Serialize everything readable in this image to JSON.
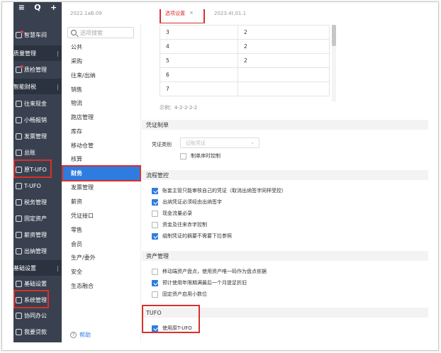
{
  "sidebar": {
    "topbar": [
      "≡",
      "Q",
      "+"
    ],
    "items": [
      {
        "label": "智慧车间",
        "type": "item",
        "dot": true
      },
      {
        "label": "质量管理",
        "type": "section"
      },
      {
        "label": "质检管理",
        "type": "item",
        "dot": true
      },
      {
        "label": "智能财税",
        "type": "section"
      },
      {
        "label": "往来现金",
        "type": "item"
      },
      {
        "label": "小畅报销",
        "type": "item"
      },
      {
        "label": "发票管理",
        "type": "item"
      },
      {
        "label": "总账",
        "type": "item"
      },
      {
        "label": "原T-UFO",
        "type": "item"
      },
      {
        "label": "T-UFO",
        "type": "item"
      },
      {
        "label": "税务管理",
        "type": "item"
      },
      {
        "label": "固定资产",
        "type": "item"
      },
      {
        "label": "薪资管理",
        "type": "item"
      },
      {
        "label": "出纳管理",
        "type": "item"
      },
      {
        "label": "基础设置",
        "type": "section"
      },
      {
        "label": "基础设置",
        "type": "item"
      },
      {
        "label": "系统管理",
        "type": "item"
      },
      {
        "label": "协同办公",
        "type": "item"
      },
      {
        "label": "我要贷款",
        "type": "item"
      }
    ]
  },
  "tabs": {
    "left": "2022.1aB.09",
    "active": "选项设置",
    "active_close": "×",
    "right": "2023.4t.01.1"
  },
  "menu": {
    "search_placeholder": "选项搜索",
    "items": [
      "公共",
      "采购",
      "往来/出纳",
      "销售",
      "物流",
      "跑店管理",
      "库存",
      "移动仓管",
      "核算",
      "财务",
      "发票管理",
      "薪资",
      "凭证接口",
      "零售",
      "会员",
      "生产/委外",
      "安全",
      "生态融合"
    ],
    "active": "财务",
    "help": "帮助",
    "help_icon": "?"
  },
  "content": {
    "table_rows": [
      [
        "3",
        "2"
      ],
      [
        "4",
        "2"
      ],
      [
        "5",
        "2"
      ],
      [
        "6",
        ""
      ],
      [
        "7",
        ""
      ]
    ],
    "example": "示例：4-2-2-2-2",
    "voucher_section": {
      "title": "凭证制单",
      "type_label": "凭证类别",
      "type_value": "记账凭证",
      "select_arrow": "⌄",
      "control": {
        "label": "制单序时控制",
        "checked": false
      }
    },
    "process_section": {
      "title": "流程管控",
      "options": [
        {
          "label": "账套主管只能审核自己的凭证（取消出纳签字同样受控）",
          "checked": true
        },
        {
          "label": "出纳凭证必须经由出纳签字",
          "checked": true
        },
        {
          "label": "现金流量必录",
          "checked": false
        },
        {
          "label": "资金及往来赤字控制",
          "checked": false
        },
        {
          "label": "组制凭证的摘要不需要下拉参照",
          "checked": true
        }
      ]
    },
    "asset_section": {
      "title": "资产管理",
      "options": [
        {
          "label": "移动端资产盘点，使用资产唯一码作为盘点依据",
          "checked": false
        },
        {
          "label": "预计使用年限期满最后一个月提足折旧",
          "checked": true
        },
        {
          "label": "固定资产启用小数位",
          "checked": false
        }
      ]
    },
    "tufo_section": {
      "title": "TUFO",
      "options": [
        {
          "label": "使用原T-UFO",
          "checked": true
        }
      ]
    }
  },
  "colors": {
    "sidebar_bg": "#394150",
    "accent": "#2f7ce0",
    "highlight": "#d9302b"
  }
}
